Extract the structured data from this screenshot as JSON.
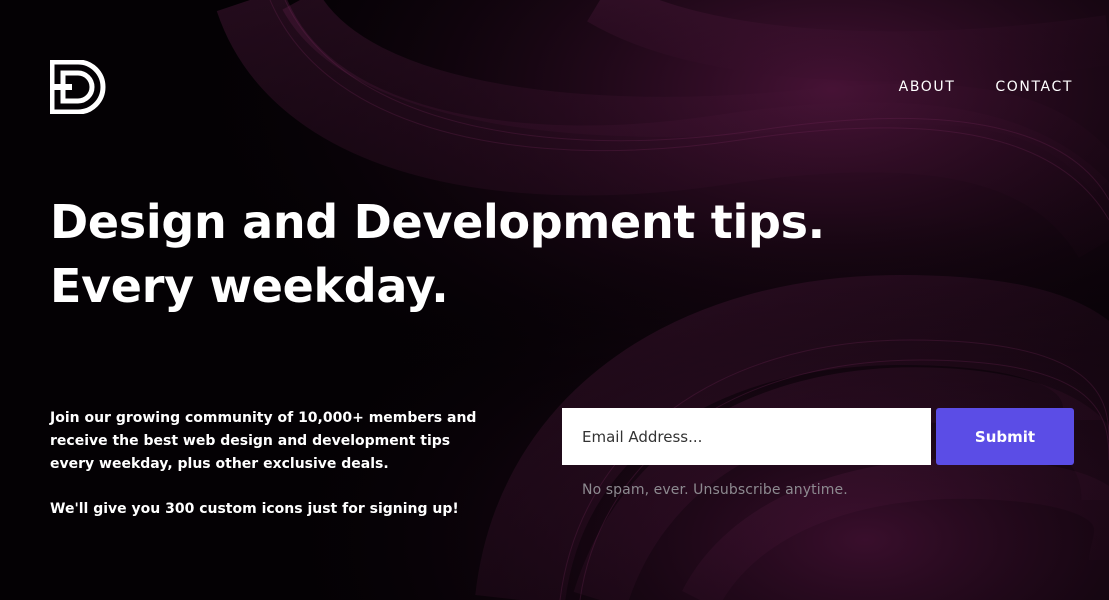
{
  "nav": {
    "items": [
      {
        "label": "ABOUT"
      },
      {
        "label": "CONTACT"
      }
    ]
  },
  "hero": {
    "headline_line1": "Design and Development tips.",
    "headline_line2": "Every weekday.",
    "blurb_paragraph1": "Join our growing community of 10,000+ members and receive the best web design and development tips every weekday, plus other exclusive deals.",
    "blurb_paragraph2": "We'll give you 300 custom icons just for signing up!"
  },
  "signup": {
    "email_placeholder": "Email Address...",
    "submit_label": "Submit",
    "note": "No spam, ever. Unsubscribe anytime."
  },
  "colors": {
    "background": "#050205",
    "accent_wave": "#5a1a42",
    "button": "#5b4de6",
    "note_text": "#8d8a90"
  },
  "icons": {
    "logo": "d-letter-logo-icon"
  }
}
